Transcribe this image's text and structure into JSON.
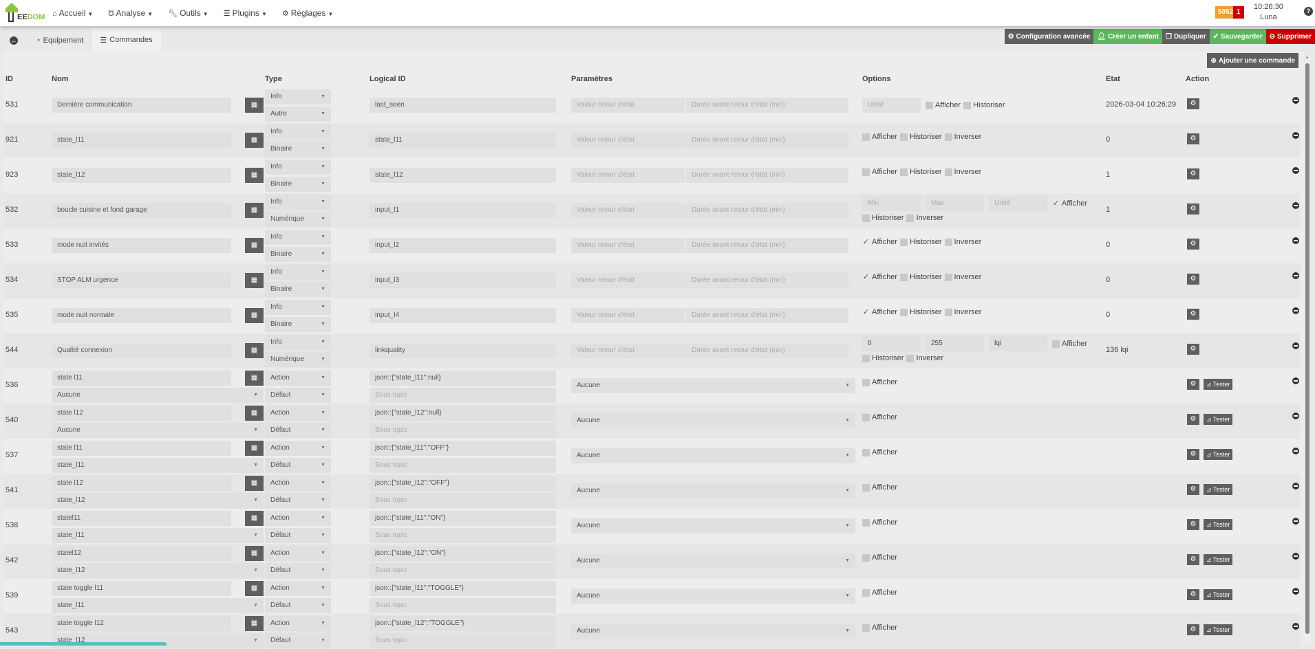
{
  "nav": {
    "logo": "JEEDOM",
    "items": [
      {
        "icon": "home-icon",
        "label": "Accueil"
      },
      {
        "icon": "stethoscope-icon",
        "label": "Analyse"
      },
      {
        "icon": "wrench-icon",
        "label": "Outils"
      },
      {
        "icon": "list-icon",
        "label": "Plugins"
      },
      {
        "icon": "gear-icon",
        "label": "Réglages"
      }
    ],
    "badge_messages": "5052",
    "badge_alerts": "1",
    "time": "10:26:30",
    "user": "Luna",
    "help": "?"
  },
  "tabs": [
    {
      "label": "Equipement"
    },
    {
      "label": "Commandes",
      "active": true
    }
  ],
  "buttons": {
    "advanced": "Configuration avancée",
    "child": "Créer un enfant",
    "duplicate": "Dupliquer",
    "save": "Sauvegarder",
    "delete": "Supprimer",
    "add_command": "Ajouter une commande",
    "test": "Tester"
  },
  "colors": {
    "accent": "#8cc63f",
    "success": "#5cb85c",
    "danger": "#cc0000",
    "dark": "#5f5f5f",
    "warning": "#f0a030"
  },
  "columns": {
    "id": "ID",
    "name": "Nom",
    "type": "Type",
    "logical_id": "Logical ID",
    "params": "Paramètres",
    "options": "Options",
    "state": "Etat",
    "action": "Action"
  },
  "placeholders": {
    "return_value": "Valeur retour d'état",
    "return_delay": "Durée avant retour d'état (min)",
    "sub_topic": "Sous topic"
  },
  "info_commands": [
    {
      "id": "531",
      "name": "Dernière communication",
      "type": "Info",
      "subtype": "Autre",
      "logical_id": "last_seen",
      "inputs": [
        {
          "value": "",
          "placeholder": "Unité"
        }
      ],
      "checks": [
        {
          "label": "Afficher",
          "checked": false
        },
        {
          "label": "Historiser",
          "checked": false
        }
      ],
      "state": "2026-03-04 10:26:29"
    },
    {
      "id": "921",
      "name": "state_l11",
      "type": "Info",
      "subtype": "Binaire",
      "logical_id": "state_l11",
      "inputs": [],
      "checks": [
        {
          "label": "Afficher",
          "checked": false
        },
        {
          "label": "Historiser",
          "checked": false
        },
        {
          "label": "Inverser",
          "checked": false
        }
      ],
      "state": "0"
    },
    {
      "id": "923",
      "name": "state_l12",
      "type": "Info",
      "subtype": "Binaire",
      "logical_id": "state_l12",
      "inputs": [],
      "checks": [
        {
          "label": "Afficher",
          "checked": false
        },
        {
          "label": "Historiser",
          "checked": false
        },
        {
          "label": "Inverser",
          "checked": false
        }
      ],
      "state": "1"
    },
    {
      "id": "532",
      "name": "boucle cuisine et fond garage",
      "type": "Info",
      "subtype": "Numérique",
      "logical_id": "input_l1",
      "inputs": [
        {
          "value": "",
          "placeholder": "Min"
        },
        {
          "value": "",
          "placeholder": "Max"
        },
        {
          "value": "",
          "placeholder": "Unité"
        }
      ],
      "checks": [
        {
          "label": "Afficher",
          "checked": true
        },
        {
          "label": "Historiser",
          "checked": false
        },
        {
          "label": "Inverser",
          "checked": false
        }
      ],
      "state": "1"
    },
    {
      "id": "533",
      "name": "mode nuit invités",
      "type": "Info",
      "subtype": "Binaire",
      "logical_id": "input_l2",
      "inputs": [],
      "checks": [
        {
          "label": "Afficher",
          "checked": true
        },
        {
          "label": "Historiser",
          "checked": false
        },
        {
          "label": "Inverser",
          "checked": false
        }
      ],
      "state": "0"
    },
    {
      "id": "534",
      "name": "STOP ALM urgence",
      "type": "Info",
      "subtype": "Binaire",
      "logical_id": "input_l3",
      "inputs": [],
      "checks": [
        {
          "label": "Afficher",
          "checked": true
        },
        {
          "label": "Historiser",
          "checked": false
        },
        {
          "label": "Inverser",
          "checked": false
        }
      ],
      "state": "0"
    },
    {
      "id": "535",
      "name": "mode nuit normale",
      "type": "Info",
      "subtype": "Binaire",
      "logical_id": "input_l4",
      "inputs": [],
      "checks": [
        {
          "label": "Afficher",
          "checked": true
        },
        {
          "label": "Historiser",
          "checked": false
        },
        {
          "label": "Inverser",
          "checked": false
        }
      ],
      "state": "0"
    },
    {
      "id": "544",
      "name": "Qualité connexion",
      "type": "Info",
      "subtype": "Numérique",
      "logical_id": "linkquality",
      "inputs": [
        {
          "value": "0",
          "placeholder": "Min"
        },
        {
          "value": "255",
          "placeholder": "Max"
        },
        {
          "value": "lqi",
          "placeholder": "Unité"
        }
      ],
      "checks": [
        {
          "label": "Afficher",
          "checked": false
        },
        {
          "label": "Historiser",
          "checked": false
        },
        {
          "label": "Inverser",
          "checked": false
        }
      ],
      "state": "136 lqi"
    }
  ],
  "action_commands": [
    {
      "id": "536",
      "name": "state l11",
      "value": "Aucune",
      "type": "Action",
      "subtype": "Défaut",
      "logical_id": "json::{\"state_l11\":null}",
      "param": "Aucune",
      "check": {
        "label": "Afficher",
        "checked": false
      }
    },
    {
      "id": "540",
      "name": "state l12",
      "value": "Aucune",
      "type": "Action",
      "subtype": "Défaut",
      "logical_id": "json::{\"state_l12\":null}",
      "param": "Aucune",
      "check": {
        "label": "Afficher",
        "checked": false
      }
    },
    {
      "id": "537",
      "name": "state l11",
      "value": "state_l11",
      "type": "Action",
      "subtype": "Défaut",
      "logical_id": "json::{\"state_l11\":\"OFF\"}",
      "param": "Aucune",
      "check": {
        "label": "Afficher",
        "checked": false
      }
    },
    {
      "id": "541",
      "name": "state l12",
      "value": "state_l12",
      "type": "Action",
      "subtype": "Défaut",
      "logical_id": "json::{\"state_l12\":\"OFF\"}",
      "param": "Aucune",
      "check": {
        "label": "Afficher",
        "checked": false
      }
    },
    {
      "id": "538",
      "name": "statel11",
      "value": "state_l11",
      "type": "Action",
      "subtype": "Défaut",
      "logical_id": "json::{\"state_l11\":\"ON\"}",
      "param": "Aucune",
      "check": {
        "label": "Afficher",
        "checked": false
      }
    },
    {
      "id": "542",
      "name": "statel12",
      "value": "state_l12",
      "type": "Action",
      "subtype": "Défaut",
      "logical_id": "json::{\"state_l12\":\"ON\"}",
      "param": "Aucune",
      "check": {
        "label": "Afficher",
        "checked": false
      }
    },
    {
      "id": "539",
      "name": "state toggle l11",
      "value": "state_l11",
      "type": "Action",
      "subtype": "Défaut",
      "logical_id": "json::{\"state_l11\":\"TOGGLE\"}",
      "param": "Aucune",
      "check": {
        "label": "Afficher",
        "checked": false
      }
    },
    {
      "id": "543",
      "name": "state toggle l12",
      "value": "state_l12",
      "type": "Action",
      "subtype": "Défaut",
      "logical_id": "json::{\"state_l12\":\"TOGGLE\"}",
      "param": "Aucune",
      "check": {
        "label": "Afficher",
        "checked": false
      }
    }
  ]
}
